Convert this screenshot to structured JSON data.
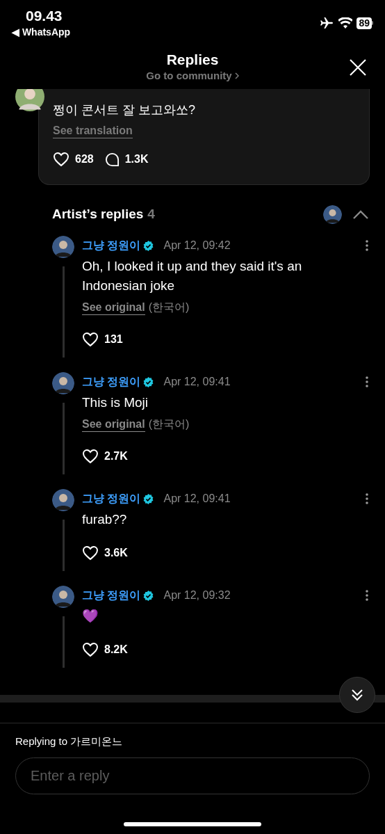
{
  "status_bar": {
    "time": "09.43",
    "back_app": "◀ WhatsApp",
    "battery": "89"
  },
  "header": {
    "title": "Replies",
    "subtitle": "Go to community"
  },
  "parent_comment": {
    "text": "쩡이 콘서트 잘 보고와쏘?",
    "translate_link": "See translation",
    "likes": "628",
    "replies": "1.3K"
  },
  "artist_replies": {
    "title": "Artist’s replies",
    "count": "4",
    "expanded": true
  },
  "replies": [
    {
      "author": "그냥 정원이",
      "time": "Apr 12, 09:42",
      "text": "Oh, I looked it up and they said it's an Indonesian joke",
      "original_link": "See original",
      "original_lang": "(한국어)",
      "likes": "131"
    },
    {
      "author": "그냥 정원이",
      "time": "Apr 12, 09:41",
      "text": "This is Moji",
      "original_link": "See original",
      "original_lang": "(한국어)",
      "likes": "2.7K"
    },
    {
      "author": "그냥 정원이",
      "time": "Apr 12, 09:41",
      "text": "furab??",
      "likes": "3.6K"
    },
    {
      "author": "그냥 정원이",
      "time": "Apr 12, 09:32",
      "text": "💜",
      "likes": "8.2K"
    }
  ],
  "reply_bar": {
    "replying_to": "Replying to 가르미온느",
    "placeholder": "Enter a reply"
  }
}
